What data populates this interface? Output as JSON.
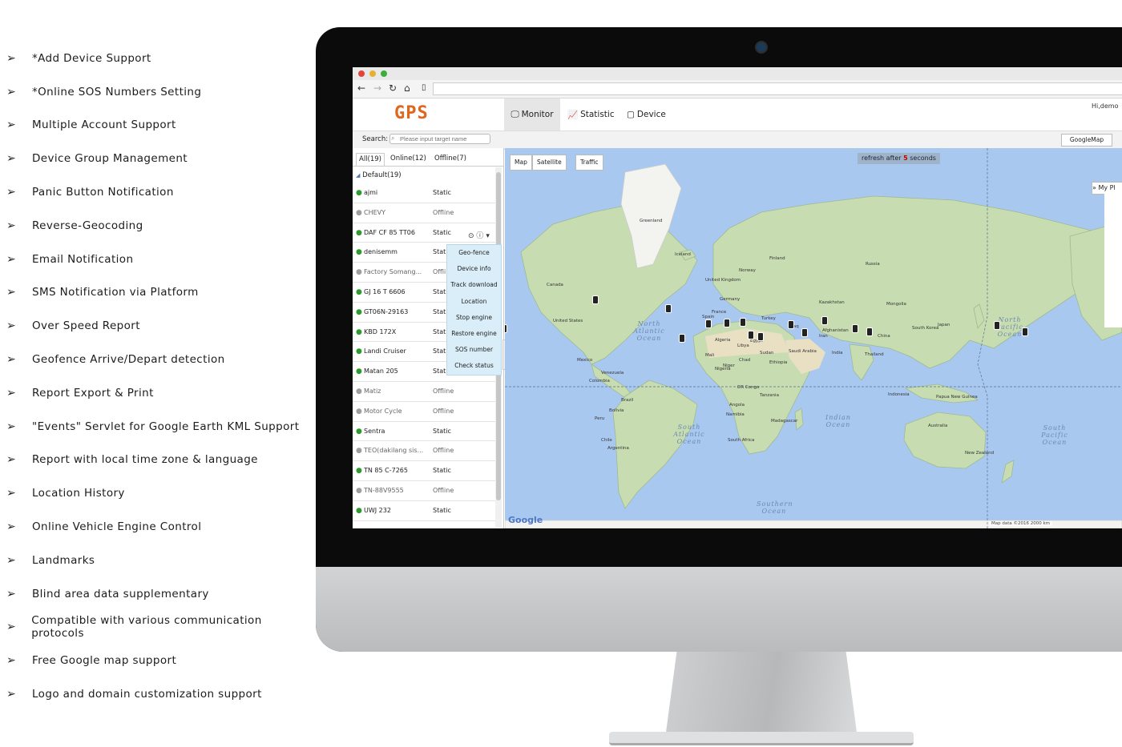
{
  "features": [
    "*Add Device Support",
    "*Online SOS Numbers Setting",
    "Multiple Account Support",
    "Device Group Management",
    "Panic Button Notification",
    "Reverse-Geocoding",
    "Email Notification",
    "SMS Notification via Platform",
    "Over Speed Report",
    "Geofence Arrive/Depart detection",
    "Report Export & Print",
    "\"Events\" Servlet for Google Earth KML Support",
    "Report with local time zone & language",
    "Location History",
    "Online Vehicle Engine Control",
    "Landmarks",
    "Blind area data supplementary",
    "Compatible with various communication protocols",
    "Free Google map support",
    "Logo and domain customization support"
  ],
  "feature_bullet": "➢",
  "app": {
    "logo": "GPS",
    "user": "Hi,demo",
    "nav": {
      "monitor": "Monitor",
      "statistic": "Statistic",
      "device": "Device"
    },
    "search": {
      "label": "Search:",
      "placeholder": "Please input target name"
    },
    "map_type": "GoogleMap",
    "tabs": {
      "all": "All(19)",
      "online": "Online(12)",
      "offline": "Offline(7)"
    },
    "group": "Default(19)",
    "devices": [
      {
        "name": "ajmi",
        "status": "Static",
        "online": true
      },
      {
        "name": "CHEVY",
        "status": "Offline",
        "online": false
      },
      {
        "name": "DAF CF 85 TT06",
        "status": "Static",
        "online": true
      },
      {
        "name": "denisemm",
        "status": "Stat",
        "online": true
      },
      {
        "name": "Factory Somang...",
        "status": "Offli",
        "online": false
      },
      {
        "name": "GJ 16 T 6606",
        "status": "Stat",
        "online": true
      },
      {
        "name": "GT06N-29163",
        "status": "Stat",
        "online": true
      },
      {
        "name": "KBD 172X",
        "status": "Stat",
        "online": true
      },
      {
        "name": "Landi Cruiser",
        "status": "Stat",
        "online": true
      },
      {
        "name": "Matan 205",
        "status": "Static",
        "online": true
      },
      {
        "name": "Matiz",
        "status": "Offline",
        "online": false
      },
      {
        "name": "Motor Cycle",
        "status": "Offline",
        "online": false
      },
      {
        "name": "Sentra",
        "status": "Static",
        "online": true
      },
      {
        "name": "TEO(dakilang sis...",
        "status": "Offline",
        "online": false
      },
      {
        "name": "TN 85 C-7265",
        "status": "Static",
        "online": true
      },
      {
        "name": "TN-88V9555",
        "status": "Offline",
        "online": false
      },
      {
        "name": "UWJ 232",
        "status": "Static",
        "online": true
      }
    ],
    "context_menu": [
      "Geo-fence",
      "Device info",
      "Track download",
      "Location",
      "Stop engine",
      "Restore engine",
      "SOS number",
      "Check status"
    ],
    "map": {
      "buttons": {
        "map": "Map",
        "satellite": "Satellite",
        "traffic": "Traffic"
      },
      "refresh_prefix": "refresh after",
      "refresh_seconds": "5",
      "refresh_suffix": "seconds",
      "my_panel": "My Pl",
      "oceans": {
        "north_atlantic": "North Atlantic Ocean",
        "north_pacific": "North Pacific Ocean",
        "south_atlantic": "South Atlantic Ocean",
        "south_pacific": "South Pacific Ocean",
        "indian": "Indian Ocean",
        "southern": "Southern Ocean"
      },
      "places": [
        "Greenland",
        "Iceland",
        "Russia",
        "Canada",
        "United States",
        "Mexico",
        "Venezuela",
        "Colombia",
        "Brazil",
        "Peru",
        "Bolivia",
        "Chile",
        "Argentina",
        "Algeria",
        "Libya",
        "Egypt",
        "Mali",
        "Niger",
        "Chad",
        "Sudan",
        "Nigeria",
        "Ethiopia",
        "DR Congo",
        "Tanzania",
        "Angola",
        "Namibia",
        "South Africa",
        "Madagascar",
        "Saudi Arabia",
        "Iran",
        "India",
        "China",
        "Mongolia",
        "Kazakhstan",
        "Thailand",
        "Indonesia",
        "Japan",
        "South Korea",
        "Papua New Guinea",
        "Australia",
        "New Zealand",
        "Norway",
        "Finland",
        "Germany",
        "France",
        "Spain",
        "Turkey",
        "Iraq",
        "Afghanistan",
        "United Kingdom"
      ],
      "google": "Google",
      "footer": "Map data ©2016   2000 km"
    }
  },
  "colors": {
    "logo": "#e0661e",
    "online": "#2c9a2c",
    "offline": "#9aa09a",
    "menu_bg": "#d9eef8",
    "ocean": "#a9c8f0",
    "land": "#c7ddb1"
  }
}
